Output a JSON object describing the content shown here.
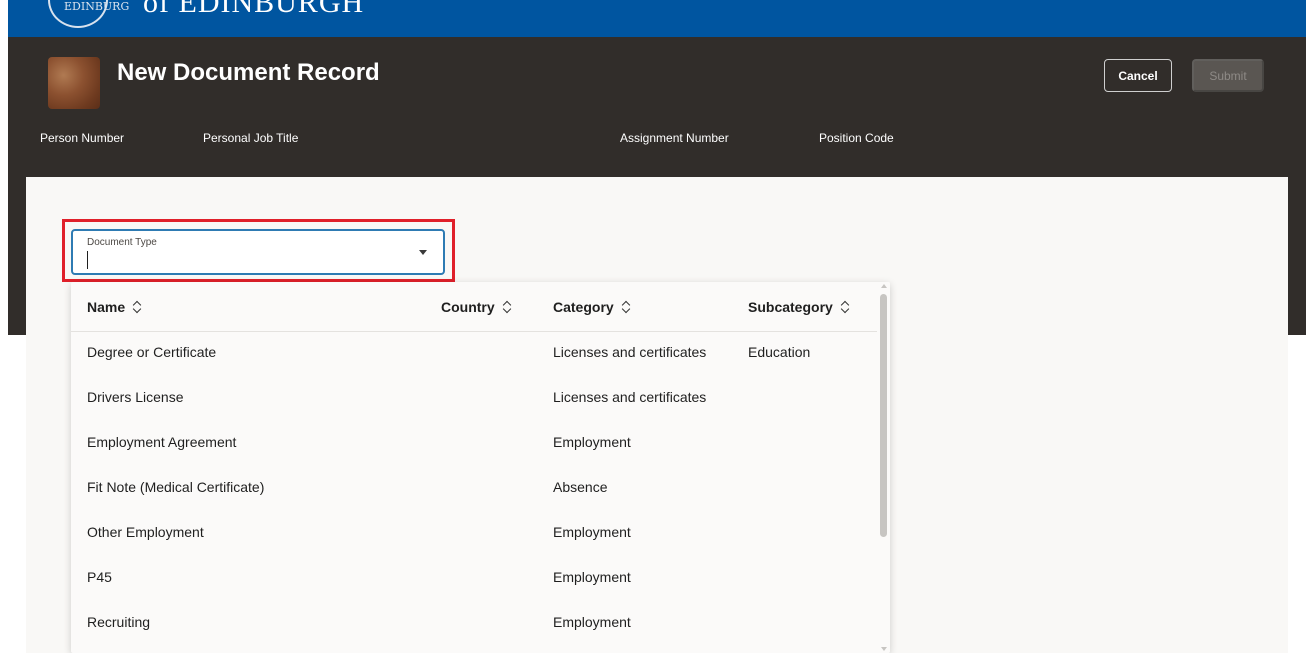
{
  "brand": {
    "crest_text": "EDINBURG",
    "name": "of EDINBURGH",
    "bar_color": "#0055a0"
  },
  "header": {
    "title": "New Document Record",
    "cancel_label": "Cancel",
    "submit_label": "Submit",
    "info_labels": {
      "person_number": "Person Number",
      "job_title": "Personal Job Title",
      "assignment_number": "Assignment Number",
      "position_code": "Position Code"
    },
    "background_color": "#312d2a"
  },
  "document_type": {
    "label": "Document Type",
    "value": "",
    "placeholder": "",
    "highlight_color": "#e0202a"
  },
  "table": {
    "columns": {
      "name": "Name",
      "country": "Country",
      "category": "Category",
      "subcategory": "Subcategory"
    },
    "rows": [
      {
        "name": "Degree or Certificate",
        "country": "",
        "category": "Licenses and certificates",
        "subcategory": "Education"
      },
      {
        "name": "Drivers License",
        "country": "",
        "category": "Licenses and certificates",
        "subcategory": ""
      },
      {
        "name": "Employment Agreement",
        "country": "",
        "category": "Employment",
        "subcategory": ""
      },
      {
        "name": "Fit Note (Medical Certificate)",
        "country": "",
        "category": "Absence",
        "subcategory": ""
      },
      {
        "name": "Other Employment",
        "country": "",
        "category": "Employment",
        "subcategory": ""
      },
      {
        "name": "P45",
        "country": "",
        "category": "Employment",
        "subcategory": ""
      },
      {
        "name": "Recruiting",
        "country": "",
        "category": "Employment",
        "subcategory": ""
      }
    ]
  }
}
